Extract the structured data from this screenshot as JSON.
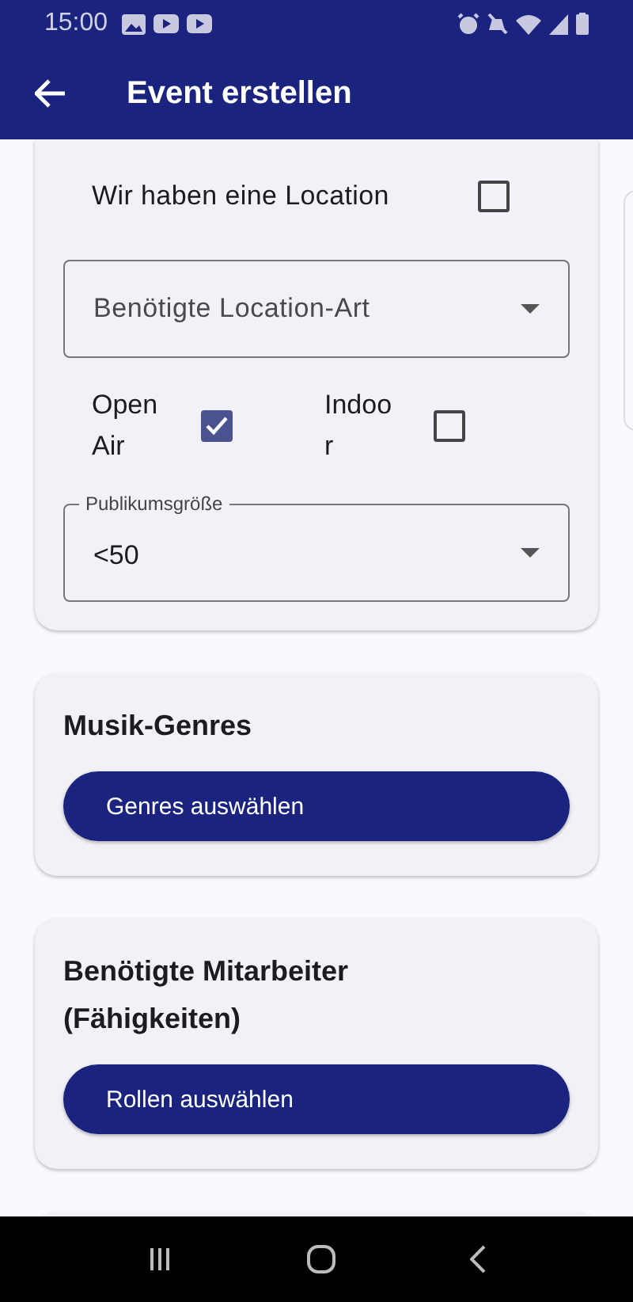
{
  "status_bar": {
    "time": "15:00"
  },
  "app_bar": {
    "title": "Event erstellen"
  },
  "location_card": {
    "has_location": {
      "label": "Wir haben eine Location",
      "checked": false
    },
    "location_type": {
      "placeholder": "Benötigte Location-Art"
    },
    "options": [
      {
        "label": "Open Air",
        "checked": true
      },
      {
        "label": "Indoor",
        "checked": false
      }
    ],
    "audience": {
      "label": "Publikumsgröße",
      "value": "<50"
    }
  },
  "cards": [
    {
      "title": "Musik-Genres",
      "button": "Genres auswählen"
    },
    {
      "title": "Benötigte Mitarbeiter (Fähigkeiten)",
      "button": "Rollen auswählen"
    }
  ]
}
